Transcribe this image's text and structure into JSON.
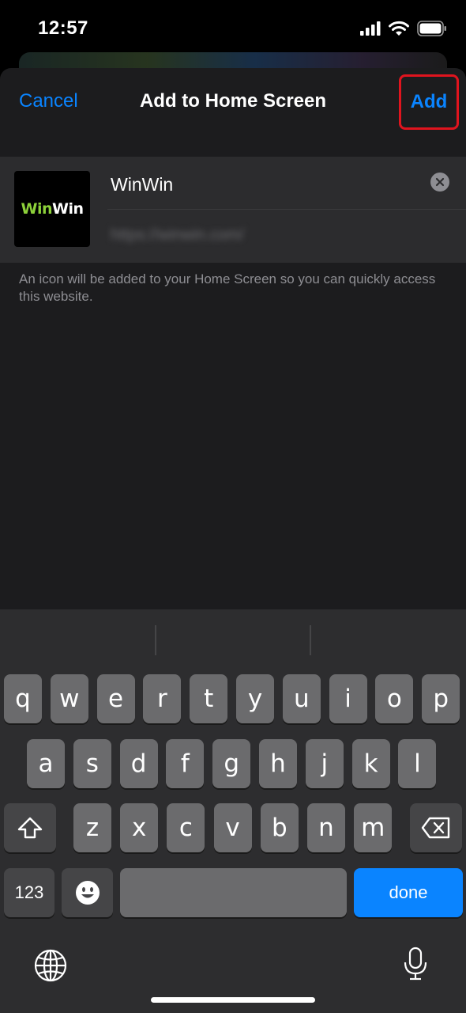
{
  "status_bar": {
    "time": "12:57"
  },
  "nav": {
    "cancel_label": "Cancel",
    "title": "Add to Home Screen",
    "add_label": "Add"
  },
  "card": {
    "icon_text_green": "Win",
    "icon_text_white": "Win",
    "name_value": "WinWin",
    "url_value": "https://winwin.com/"
  },
  "help_text": "An icon will be added to your Home Screen so you can quickly access this website.",
  "keyboard": {
    "row1": [
      "q",
      "w",
      "e",
      "r",
      "t",
      "y",
      "u",
      "i",
      "o",
      "p"
    ],
    "row2": [
      "a",
      "s",
      "d",
      "f",
      "g",
      "h",
      "j",
      "k",
      "l"
    ],
    "row3": [
      "z",
      "x",
      "c",
      "v",
      "b",
      "n",
      "m"
    ],
    "numbers_label": "123",
    "done_label": "done"
  },
  "colors": {
    "accent": "#0a84ff",
    "highlight_box": "#e0141e",
    "logo_green": "#8dd13a"
  },
  "icons": [
    "cellular-signal-icon",
    "wifi-icon",
    "battery-icon",
    "clear-icon",
    "shift-icon",
    "backspace-icon",
    "emoji-icon",
    "globe-icon",
    "microphone-icon"
  ]
}
